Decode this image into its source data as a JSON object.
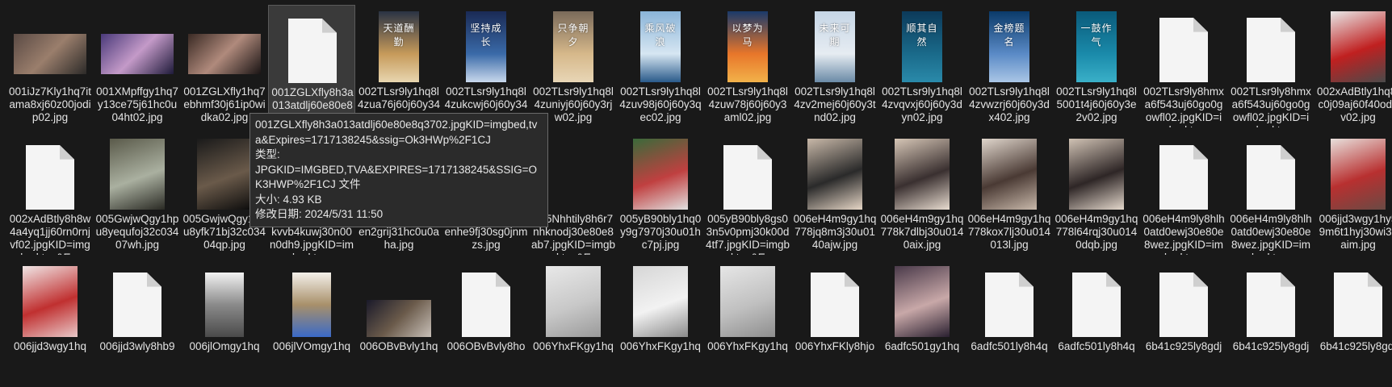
{
  "files": [
    {
      "name": "001iJz7Kly1hq7itama8xj60z00jodip02.jpg",
      "thumb": "photo-landscape",
      "colors": [
        "#5a4a44",
        "#9a7e6c",
        "#2c2a28"
      ]
    },
    {
      "name": "001XMpffgy1hq7y13ce75j61hc0u04ht02.jpg",
      "thumb": "photo-landscape",
      "colors": [
        "#4a3a7a",
        "#c49ac8",
        "#1e1a3a"
      ]
    },
    {
      "name": "001ZGLXfly1hq7ebhmf30j61ip0widka02.jpg",
      "thumb": "photo-landscape",
      "colors": [
        "#3a2a24",
        "#b08a7c",
        "#1a1414"
      ]
    },
    {
      "name": "001ZGLXfly8h3a013atdlj60e80e8q3702.jpgKID=imgbed,tva&Expires=1717138245&ssig=Ok3HWp%2F1CJ",
      "display": "001ZGLXfly8h3a013atdlj60e80e8q3702.jpgKID",
      "thumb": "file",
      "selected": true
    },
    {
      "name": "002TLsr9ly1hq8l4zua76j60j60y346c02.jpg",
      "thumb": "poster",
      "title": "天道酬勤",
      "colors": [
        "#2a3344",
        "#c69a5a",
        "#e8d6b0"
      ]
    },
    {
      "name": "002TLsr9ly1hq8l4zukcwj60j60y348n02.jpg",
      "thumb": "poster",
      "title": "坚持成长",
      "colors": [
        "#1a2a55",
        "#3a6aa8",
        "#c8d8ec"
      ]
    },
    {
      "name": "002TLsr9ly1hq8l4zuniyj60j60y3rjw02.jpg",
      "thumb": "poster",
      "title": "只争朝夕",
      "colors": [
        "#7a6a5a",
        "#d6b88a",
        "#e8d6b6"
      ]
    },
    {
      "name": "002TLsr9ly1hq8l4zuv98j60j60y3qec02.jpg",
      "thumb": "poster",
      "title": "乘风破浪",
      "colors": [
        "#8ab4d8",
        "#d6e6f2",
        "#2a5a8a"
      ]
    },
    {
      "name": "002TLsr9ly1hq8l4zuw78j60j60y3aml02.jpg",
      "thumb": "poster",
      "title": "以梦为马",
      "colors": [
        "#1a3a6a",
        "#e8762a",
        "#f2b24a"
      ]
    },
    {
      "name": "002TLsr9ly1hq8l4zv2mej60j60y3tnd02.jpg",
      "thumb": "poster",
      "title": "未来可期",
      "colors": [
        "#c6d6e6",
        "#e6ecf2",
        "#6a8aa6"
      ]
    },
    {
      "name": "002TLsr9ly1hq8l4zvqvxj60j60y3dyn02.jpg",
      "thumb": "poster",
      "title": "顺其自然",
      "colors": [
        "#0c3a5a",
        "#1a6a8a",
        "#2a8aaa"
      ]
    },
    {
      "name": "002TLsr9ly1hq8l4zvwzrj60j60y3dx402.jpg",
      "thumb": "poster",
      "title": "金榜题名",
      "colors": [
        "#0a3a6a",
        "#5a8ac6",
        "#aac6e6"
      ]
    },
    {
      "name": "002TLsr9ly1hq8l5001t4j60j60y3e2v02.jpg",
      "thumb": "poster",
      "title": "一鼓作气",
      "colors": [
        "#0a5a7a",
        "#1a8aaa",
        "#3ab0c8"
      ]
    },
    {
      "name": "002TLsr9ly8hmxa6f543uj60go0gowfl02.jpgKID=imgbed,tva...",
      "thumb": "file"
    },
    {
      "name": "002TLsr9ly8hmxa6f543uj60go0gowfl02.jpgKID=imgbed,tva...",
      "thumb": "file"
    },
    {
      "name": "002xAdBtly1hq8fc0j09aj60f40odgv02.jpg",
      "thumb": "photo-portrait",
      "colors": [
        "#e8e8e8",
        "#c02020",
        "#4a4a4a"
      ]
    },
    {
      "name": "002xAdBtly8h8w4a4yq1jj60rn0rnjvf02.jpgKID=imgbed,tva&E...",
      "thumb": "file"
    },
    {
      "name": "005GwjwQgy1hpu8yequfoj32c03407wh.jpg",
      "thumb": "photo-portrait",
      "colors": [
        "#5a5a4a",
        "#aab0a0",
        "#2a2a24"
      ]
    },
    {
      "name": "005GwjwQgy1hpu8yfk71bj32c03404qp.jpg",
      "thumb": "photo-portrait",
      "colors": [
        "#1a1a1a",
        "#6a5a4a",
        "#0c0c0c"
      ]
    },
    {
      "name": "005GwjwQly8hpkvvb4kuwj30n00n0dh9.jpgKID=imgbed,tva...",
      "thumb": "none"
    },
    {
      "name": "005Nhhtigy1hq6ten2grij31hc0u0aha.jpg",
      "thumb": "none"
    },
    {
      "name": "005Nhhtigy1hq6tenhe9fj30sg0jnmzs.jpg",
      "thumb": "none"
    },
    {
      "name": "005Nhhtily8h6r7nhknodj30e80e8ab7.jpgKID=imgbed,tva&E...",
      "thumb": "none"
    },
    {
      "name": "005yB90bly1hq0y9g7970j30u01hc7pj.jpg",
      "thumb": "photo-portrait",
      "colors": [
        "#3a6a3a",
        "#c04040",
        "#e0e0e0"
      ]
    },
    {
      "name": "005yB90bly8gs03n5v0pmj30k00d4tf7.jpgKID=imgbed,tva&E...",
      "thumb": "file"
    },
    {
      "name": "006eH4m9gy1hq778jq8m3j30u0140ajw.jpg",
      "thumb": "photo-portrait",
      "colors": [
        "#c8b8a8",
        "#2a2a2a",
        "#e6d6c6"
      ]
    },
    {
      "name": "006eH4m9gy1hq778k7dlbj30u0140aix.jpg",
      "thumb": "photo-portrait",
      "colors": [
        "#d6c6b6",
        "#3a3030",
        "#e8dcd0"
      ]
    },
    {
      "name": "006eH4m9gy1hq778kox7lj30u014013l.jpg",
      "thumb": "photo-portrait",
      "colors": [
        "#e0d6cc",
        "#4a3a34",
        "#c8b8aa"
      ]
    },
    {
      "name": "006eH4m9gy1hq778l64rqj30u0140dqb.jpg",
      "thumb": "photo-portrait",
      "colors": [
        "#d0c2b4",
        "#2e2626",
        "#e4d8cc"
      ]
    },
    {
      "name": "006eH4m9ly8hlh0atd0ewj30e80e8wez.jpgKID=imgbed,tva...",
      "thumb": "file"
    },
    {
      "name": "006eH4m9ly8hlh0atd0ewj30e80e8wez.jpgKID=imgbed,tva...",
      "thumb": "file"
    },
    {
      "name": "006jjd3wgy1hy59m6t1hyj30wi3xaim.jpg",
      "thumb": "photo-portrait",
      "colors": [
        "#e8e0dc",
        "#b83030",
        "#6a4a44"
      ]
    },
    {
      "name": "006jjd3wgy1hq",
      "thumb": "photo-portrait",
      "colors": [
        "#f0e6e6",
        "#c03030",
        "#e8c8c8"
      ]
    },
    {
      "name": "006jjd3wly8hb9",
      "thumb": "file"
    },
    {
      "name": "006jlOmgy1hq",
      "thumb": "photo-small",
      "colors": [
        "#f2f2f2",
        "#8a8a8a",
        "#4a4a4a"
      ]
    },
    {
      "name": "006jlVOmgy1hq",
      "thumb": "photo-small",
      "colors": [
        "#f4f0ea",
        "#a8906a",
        "#3a6ac8"
      ]
    },
    {
      "name": "006OBvBvly1hq",
      "thumb": "photo-wide",
      "colors": [
        "#1a1a2a",
        "#6a5a4a",
        "#c8c0b8"
      ]
    },
    {
      "name": "006OBvBvly8ho",
      "thumb": "file"
    },
    {
      "name": "006YhxFKgy1hq",
      "thumb": "photo-portrait",
      "colors": [
        "#e8e8e8",
        "#c8c8c8",
        "#9a9a9a"
      ]
    },
    {
      "name": "006YhxFKgy1hq",
      "thumb": "photo-portrait",
      "colors": [
        "#d6d6d6",
        "#f2f2f2",
        "#8a8a8a"
      ]
    },
    {
      "name": "006YhxFKgy1hq",
      "thumb": "photo-portrait",
      "colors": [
        "#e6e6e6",
        "#c0c0c0",
        "#8e8e8e"
      ]
    },
    {
      "name": "006YhxFKly8hjo",
      "thumb": "file"
    },
    {
      "name": "6adfc501gy1hq",
      "thumb": "photo-portrait",
      "colors": [
        "#4a3a4a",
        "#c8a8a8",
        "#2a2030"
      ]
    },
    {
      "name": "6adfc501ly8h4q",
      "thumb": "file"
    },
    {
      "name": "6adfc501ly8h4q",
      "thumb": "file"
    },
    {
      "name": "6b41c925ly8gdj",
      "thumb": "file"
    },
    {
      "name": "6b41c925ly8gdj",
      "thumb": "file"
    },
    {
      "name": "6b41c925ly8gdj",
      "thumb": "file"
    }
  ],
  "tooltip": {
    "line1": "001ZGLXfly8h3a013atdlj60e80e8q3702.jpgKID=imgbed,tva&Expires=1717138245&ssig=Ok3HWp%2F1CJ",
    "type_label": "类型:",
    "type_value": "JPGKID=IMGBED,TVA&EXPIRES=1717138245&SSIG=OK3HWP%2F1CJ 文件",
    "size": "大小: 4.93 KB",
    "modified": "修改日期: 2024/5/31 11:50"
  }
}
